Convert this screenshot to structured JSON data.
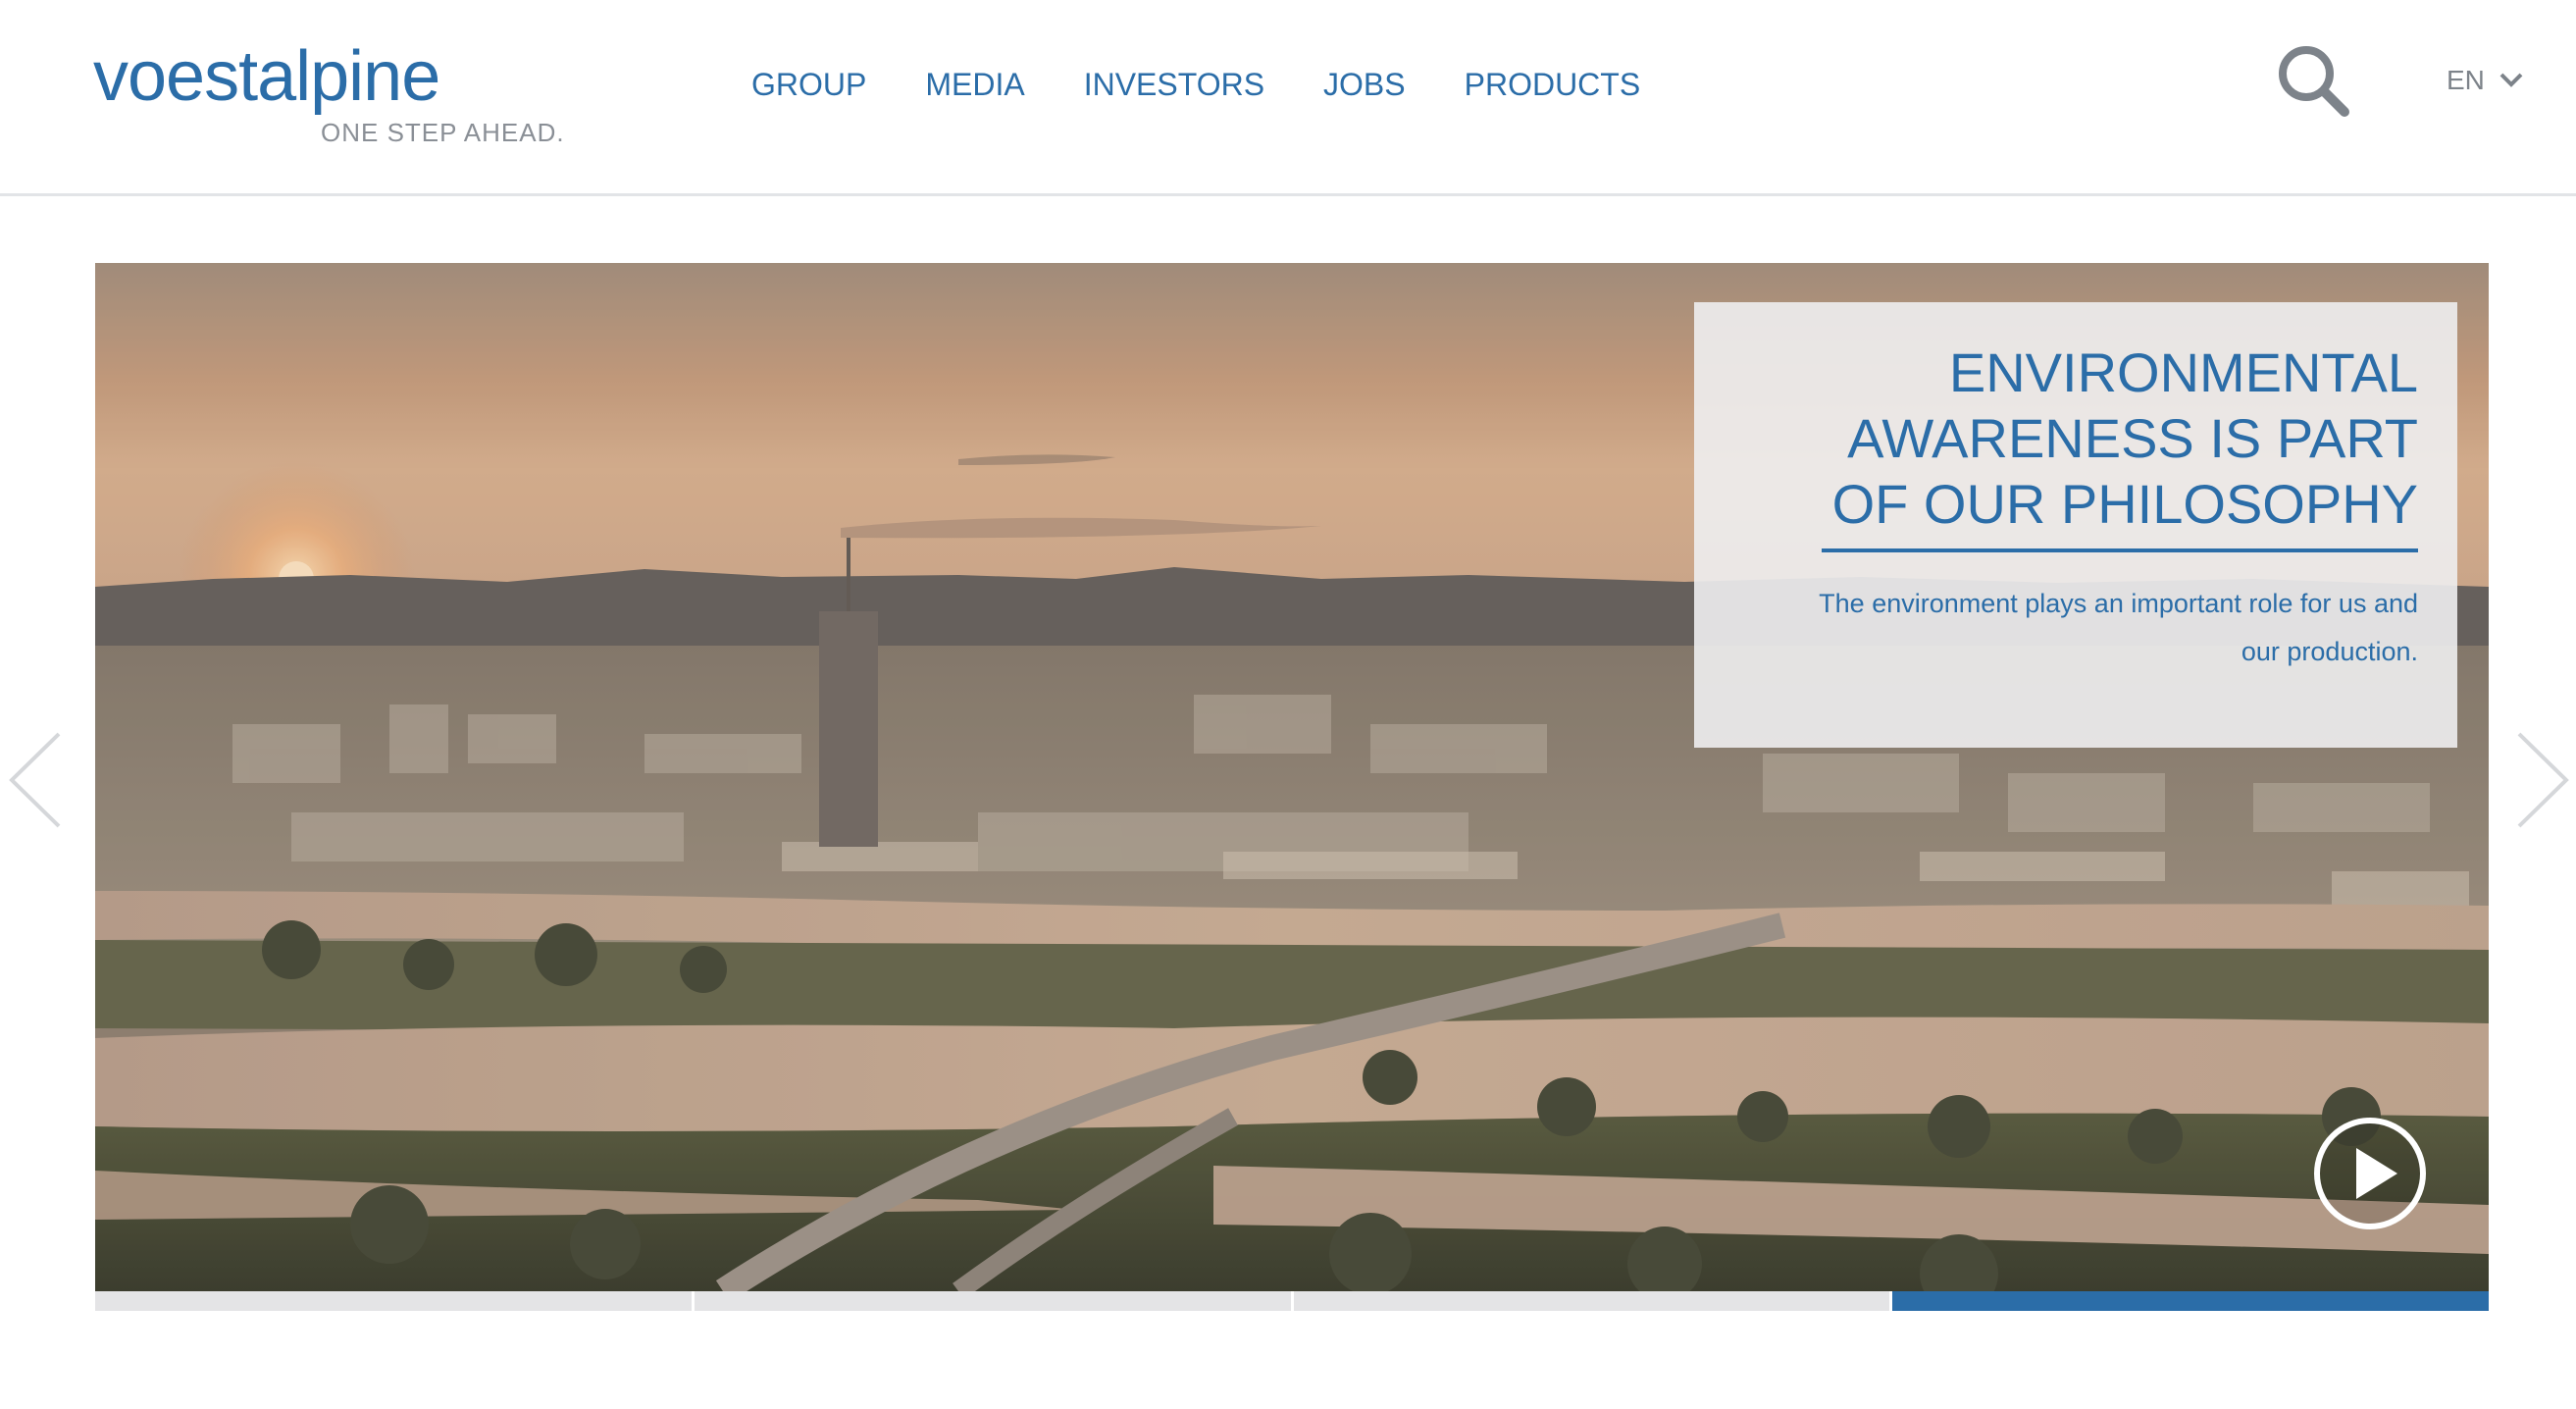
{
  "brand": {
    "name": "voestalpine",
    "tagline": "ONE STEP AHEAD.",
    "color": "#2b6da8"
  },
  "nav": {
    "items": [
      {
        "label": "GROUP"
      },
      {
        "label": "MEDIA"
      },
      {
        "label": "INVESTORS"
      },
      {
        "label": "JOBS"
      },
      {
        "label": "PRODUCTS"
      }
    ]
  },
  "header": {
    "search_icon": "search-icon",
    "language": {
      "selected": "EN",
      "icon": "chevron-down-icon"
    }
  },
  "hero": {
    "title": "ENVIRONMENTAL AWARENESS IS PART OF OUR PHILOSOPHY",
    "text": "The environment plays an important role for us and our production.",
    "play_icon": "play-icon",
    "prev_icon": "chevron-left-icon",
    "next_icon": "chevron-right-icon",
    "slides_total": 4,
    "active_slide": 4
  }
}
